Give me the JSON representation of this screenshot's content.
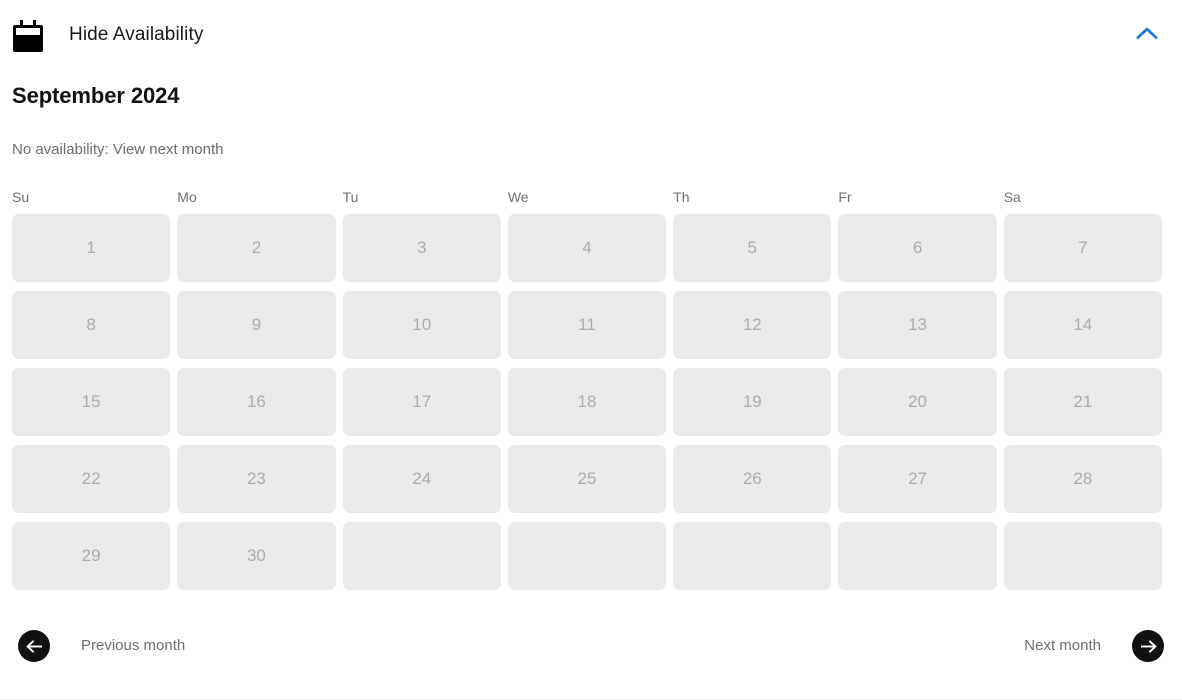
{
  "header": {
    "icon": "calendar-icon",
    "title": "Hide Availability",
    "collapse_icon": "chevron-up-icon",
    "accent_color": "#1a73e8"
  },
  "calendar": {
    "month_title": "September 2024",
    "status_text": "No availability: View next month",
    "day_headers": [
      "Su",
      "Mo",
      "Tu",
      "We",
      "Th",
      "Fr",
      "Sa"
    ],
    "cell_bg_color": "#eaeaea",
    "cell_text_color": "#adadad",
    "weeks": [
      [
        "1",
        "2",
        "3",
        "4",
        "5",
        "6",
        "7"
      ],
      [
        "8",
        "9",
        "10",
        "11",
        "12",
        "13",
        "14"
      ],
      [
        "15",
        "16",
        "17",
        "18",
        "19",
        "20",
        "21"
      ],
      [
        "22",
        "23",
        "24",
        "25",
        "26",
        "27",
        "28"
      ],
      [
        "29",
        "30",
        "",
        "",
        "",
        "",
        ""
      ]
    ]
  },
  "footer": {
    "prev_label": "Previous month",
    "prev_icon": "arrow-left-icon",
    "next_label": "Next month",
    "next_icon": "arrow-right-icon"
  }
}
